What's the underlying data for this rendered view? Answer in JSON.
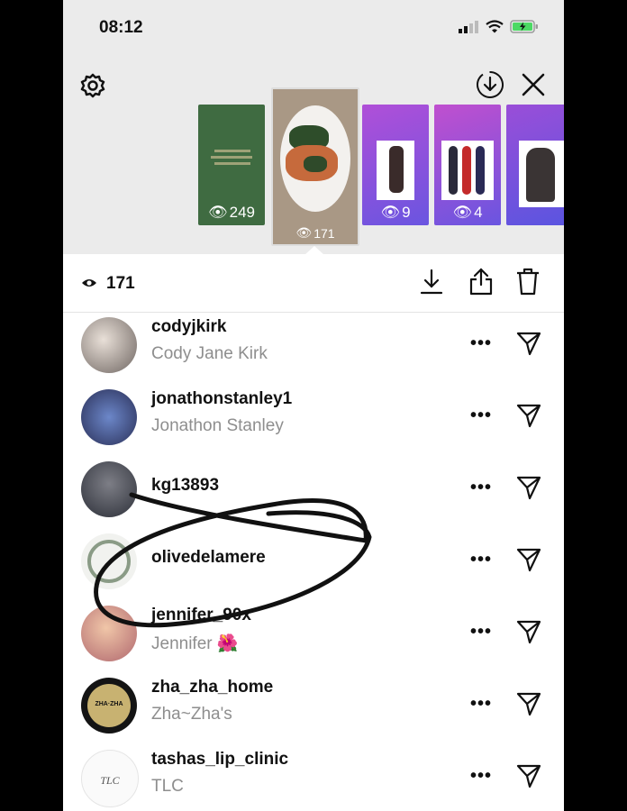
{
  "status_bar": {
    "time": "08:12"
  },
  "stories": [
    {
      "views": "249",
      "color": "#3f6b41"
    },
    {
      "views": "171",
      "color": "#a99885",
      "selected": true
    },
    {
      "views": "9",
      "color": "#8e50d8"
    },
    {
      "views": "4",
      "color": "#9b4ed6"
    },
    {
      "views": "",
      "color": "#7a4cd6"
    }
  ],
  "toolbar": {
    "view_count": "171"
  },
  "viewers": [
    {
      "username": "codyjkirk",
      "full_name": "Cody Jane Kirk"
    },
    {
      "username": "jonathonstanley1",
      "full_name": "Jonathon Stanley"
    },
    {
      "username": "kg13893",
      "full_name": ""
    },
    {
      "username": "olivedelamere",
      "full_name": ""
    },
    {
      "username": "jennifer_90x",
      "full_name": "Jennifer 🌺"
    },
    {
      "username": "zha_zha_home",
      "full_name": "Zha~Zha's"
    },
    {
      "username": "tashas_lip_clinic",
      "full_name": "TLC"
    }
  ],
  "avatar_text": {
    "zha_zha": "ZHA·ZHA",
    "tlc": "TLC"
  },
  "more_label": "•••",
  "icons": {
    "settings": "gear-icon",
    "download_circle": "download-circle-icon",
    "close": "close-icon",
    "eye": "eye-icon",
    "download": "download-icon",
    "share": "share-icon",
    "trash": "trash-icon",
    "send": "send-icon"
  },
  "colors": {
    "annotation": "#111111",
    "secondary_text": "#8e8e8e"
  }
}
